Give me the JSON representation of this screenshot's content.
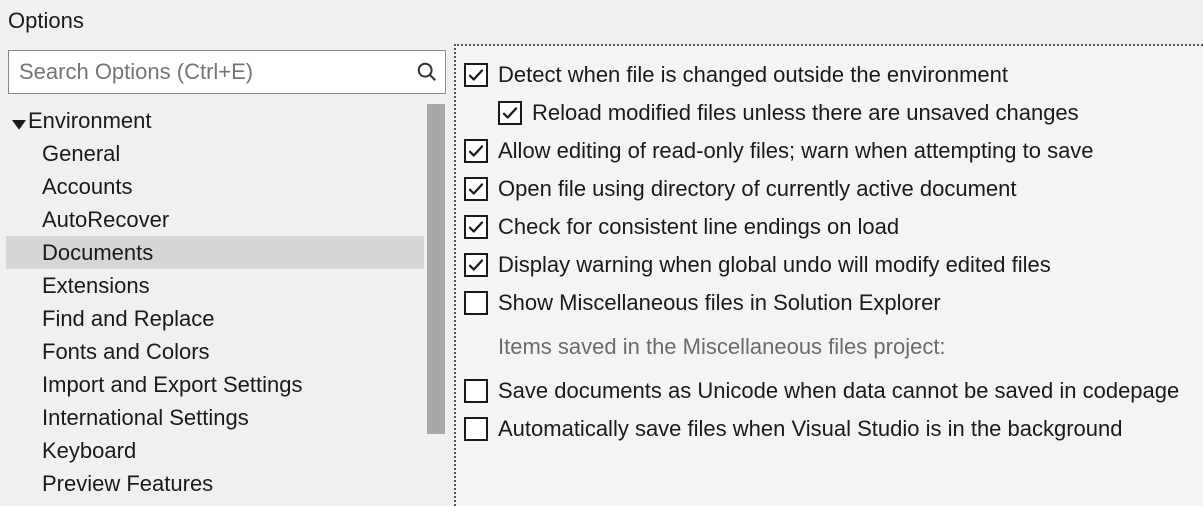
{
  "window": {
    "title": "Options"
  },
  "search": {
    "placeholder": "Search Options (Ctrl+E)"
  },
  "tree": {
    "category": "Environment",
    "items": [
      {
        "label": "General",
        "selected": false
      },
      {
        "label": "Accounts",
        "selected": false
      },
      {
        "label": "AutoRecover",
        "selected": false
      },
      {
        "label": "Documents",
        "selected": true
      },
      {
        "label": "Extensions",
        "selected": false
      },
      {
        "label": "Find and Replace",
        "selected": false
      },
      {
        "label": "Fonts and Colors",
        "selected": false
      },
      {
        "label": "Import and Export Settings",
        "selected": false
      },
      {
        "label": "International Settings",
        "selected": false
      },
      {
        "label": "Keyboard",
        "selected": false
      },
      {
        "label": "Preview Features",
        "selected": false
      }
    ]
  },
  "options": [
    {
      "label": "Detect when file is changed outside the environment",
      "checked": true,
      "indent": 0
    },
    {
      "label": "Reload modified files unless there are unsaved changes",
      "checked": true,
      "indent": 1
    },
    {
      "label": "Allow editing of read-only files; warn when attempting to save",
      "checked": true,
      "indent": 0
    },
    {
      "label": "Open file using directory of currently active document",
      "checked": true,
      "indent": 0
    },
    {
      "label": "Check for consistent line endings on load",
      "checked": true,
      "indent": 0
    },
    {
      "label": "Display warning when global undo will modify edited files",
      "checked": true,
      "indent": 0
    },
    {
      "label": "Show Miscellaneous files in Solution Explorer",
      "checked": false,
      "indent": 0
    }
  ],
  "sublabel": "Items saved in the Miscellaneous files project:",
  "options2": [
    {
      "label": "Save documents as Unicode when data cannot be saved in codepage",
      "checked": false,
      "indent": 0
    },
    {
      "label": "Automatically save files when Visual Studio is in the background",
      "checked": false,
      "indent": 0
    }
  ]
}
